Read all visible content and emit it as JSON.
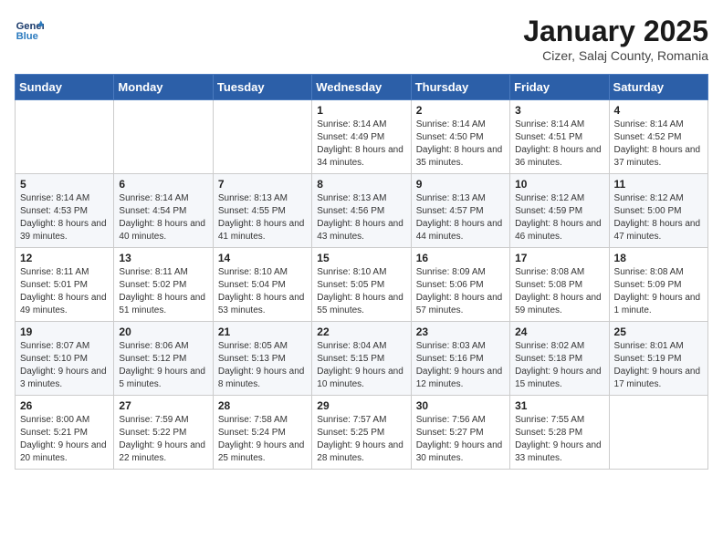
{
  "header": {
    "logo_line1": "General",
    "logo_line2": "Blue",
    "month": "January 2025",
    "location": "Cizer, Salaj County, Romania"
  },
  "weekdays": [
    "Sunday",
    "Monday",
    "Tuesday",
    "Wednesday",
    "Thursday",
    "Friday",
    "Saturday"
  ],
  "weeks": [
    [
      {
        "day": "",
        "sunrise": "",
        "sunset": "",
        "daylight": ""
      },
      {
        "day": "",
        "sunrise": "",
        "sunset": "",
        "daylight": ""
      },
      {
        "day": "",
        "sunrise": "",
        "sunset": "",
        "daylight": ""
      },
      {
        "day": "1",
        "sunrise": "Sunrise: 8:14 AM",
        "sunset": "Sunset: 4:49 PM",
        "daylight": "Daylight: 8 hours and 34 minutes."
      },
      {
        "day": "2",
        "sunrise": "Sunrise: 8:14 AM",
        "sunset": "Sunset: 4:50 PM",
        "daylight": "Daylight: 8 hours and 35 minutes."
      },
      {
        "day": "3",
        "sunrise": "Sunrise: 8:14 AM",
        "sunset": "Sunset: 4:51 PM",
        "daylight": "Daylight: 8 hours and 36 minutes."
      },
      {
        "day": "4",
        "sunrise": "Sunrise: 8:14 AM",
        "sunset": "Sunset: 4:52 PM",
        "daylight": "Daylight: 8 hours and 37 minutes."
      }
    ],
    [
      {
        "day": "5",
        "sunrise": "Sunrise: 8:14 AM",
        "sunset": "Sunset: 4:53 PM",
        "daylight": "Daylight: 8 hours and 39 minutes."
      },
      {
        "day": "6",
        "sunrise": "Sunrise: 8:14 AM",
        "sunset": "Sunset: 4:54 PM",
        "daylight": "Daylight: 8 hours and 40 minutes."
      },
      {
        "day": "7",
        "sunrise": "Sunrise: 8:13 AM",
        "sunset": "Sunset: 4:55 PM",
        "daylight": "Daylight: 8 hours and 41 minutes."
      },
      {
        "day": "8",
        "sunrise": "Sunrise: 8:13 AM",
        "sunset": "Sunset: 4:56 PM",
        "daylight": "Daylight: 8 hours and 43 minutes."
      },
      {
        "day": "9",
        "sunrise": "Sunrise: 8:13 AM",
        "sunset": "Sunset: 4:57 PM",
        "daylight": "Daylight: 8 hours and 44 minutes."
      },
      {
        "day": "10",
        "sunrise": "Sunrise: 8:12 AM",
        "sunset": "Sunset: 4:59 PM",
        "daylight": "Daylight: 8 hours and 46 minutes."
      },
      {
        "day": "11",
        "sunrise": "Sunrise: 8:12 AM",
        "sunset": "Sunset: 5:00 PM",
        "daylight": "Daylight: 8 hours and 47 minutes."
      }
    ],
    [
      {
        "day": "12",
        "sunrise": "Sunrise: 8:11 AM",
        "sunset": "Sunset: 5:01 PM",
        "daylight": "Daylight: 8 hours and 49 minutes."
      },
      {
        "day": "13",
        "sunrise": "Sunrise: 8:11 AM",
        "sunset": "Sunset: 5:02 PM",
        "daylight": "Daylight: 8 hours and 51 minutes."
      },
      {
        "day": "14",
        "sunrise": "Sunrise: 8:10 AM",
        "sunset": "Sunset: 5:04 PM",
        "daylight": "Daylight: 8 hours and 53 minutes."
      },
      {
        "day": "15",
        "sunrise": "Sunrise: 8:10 AM",
        "sunset": "Sunset: 5:05 PM",
        "daylight": "Daylight: 8 hours and 55 minutes."
      },
      {
        "day": "16",
        "sunrise": "Sunrise: 8:09 AM",
        "sunset": "Sunset: 5:06 PM",
        "daylight": "Daylight: 8 hours and 57 minutes."
      },
      {
        "day": "17",
        "sunrise": "Sunrise: 8:08 AM",
        "sunset": "Sunset: 5:08 PM",
        "daylight": "Daylight: 8 hours and 59 minutes."
      },
      {
        "day": "18",
        "sunrise": "Sunrise: 8:08 AM",
        "sunset": "Sunset: 5:09 PM",
        "daylight": "Daylight: 9 hours and 1 minute."
      }
    ],
    [
      {
        "day": "19",
        "sunrise": "Sunrise: 8:07 AM",
        "sunset": "Sunset: 5:10 PM",
        "daylight": "Daylight: 9 hours and 3 minutes."
      },
      {
        "day": "20",
        "sunrise": "Sunrise: 8:06 AM",
        "sunset": "Sunset: 5:12 PM",
        "daylight": "Daylight: 9 hours and 5 minutes."
      },
      {
        "day": "21",
        "sunrise": "Sunrise: 8:05 AM",
        "sunset": "Sunset: 5:13 PM",
        "daylight": "Daylight: 9 hours and 8 minutes."
      },
      {
        "day": "22",
        "sunrise": "Sunrise: 8:04 AM",
        "sunset": "Sunset: 5:15 PM",
        "daylight": "Daylight: 9 hours and 10 minutes."
      },
      {
        "day": "23",
        "sunrise": "Sunrise: 8:03 AM",
        "sunset": "Sunset: 5:16 PM",
        "daylight": "Daylight: 9 hours and 12 minutes."
      },
      {
        "day": "24",
        "sunrise": "Sunrise: 8:02 AM",
        "sunset": "Sunset: 5:18 PM",
        "daylight": "Daylight: 9 hours and 15 minutes."
      },
      {
        "day": "25",
        "sunrise": "Sunrise: 8:01 AM",
        "sunset": "Sunset: 5:19 PM",
        "daylight": "Daylight: 9 hours and 17 minutes."
      }
    ],
    [
      {
        "day": "26",
        "sunrise": "Sunrise: 8:00 AM",
        "sunset": "Sunset: 5:21 PM",
        "daylight": "Daylight: 9 hours and 20 minutes."
      },
      {
        "day": "27",
        "sunrise": "Sunrise: 7:59 AM",
        "sunset": "Sunset: 5:22 PM",
        "daylight": "Daylight: 9 hours and 22 minutes."
      },
      {
        "day": "28",
        "sunrise": "Sunrise: 7:58 AM",
        "sunset": "Sunset: 5:24 PM",
        "daylight": "Daylight: 9 hours and 25 minutes."
      },
      {
        "day": "29",
        "sunrise": "Sunrise: 7:57 AM",
        "sunset": "Sunset: 5:25 PM",
        "daylight": "Daylight: 9 hours and 28 minutes."
      },
      {
        "day": "30",
        "sunrise": "Sunrise: 7:56 AM",
        "sunset": "Sunset: 5:27 PM",
        "daylight": "Daylight: 9 hours and 30 minutes."
      },
      {
        "day": "31",
        "sunrise": "Sunrise: 7:55 AM",
        "sunset": "Sunset: 5:28 PM",
        "daylight": "Daylight: 9 hours and 33 minutes."
      },
      {
        "day": "",
        "sunrise": "",
        "sunset": "",
        "daylight": ""
      }
    ]
  ]
}
